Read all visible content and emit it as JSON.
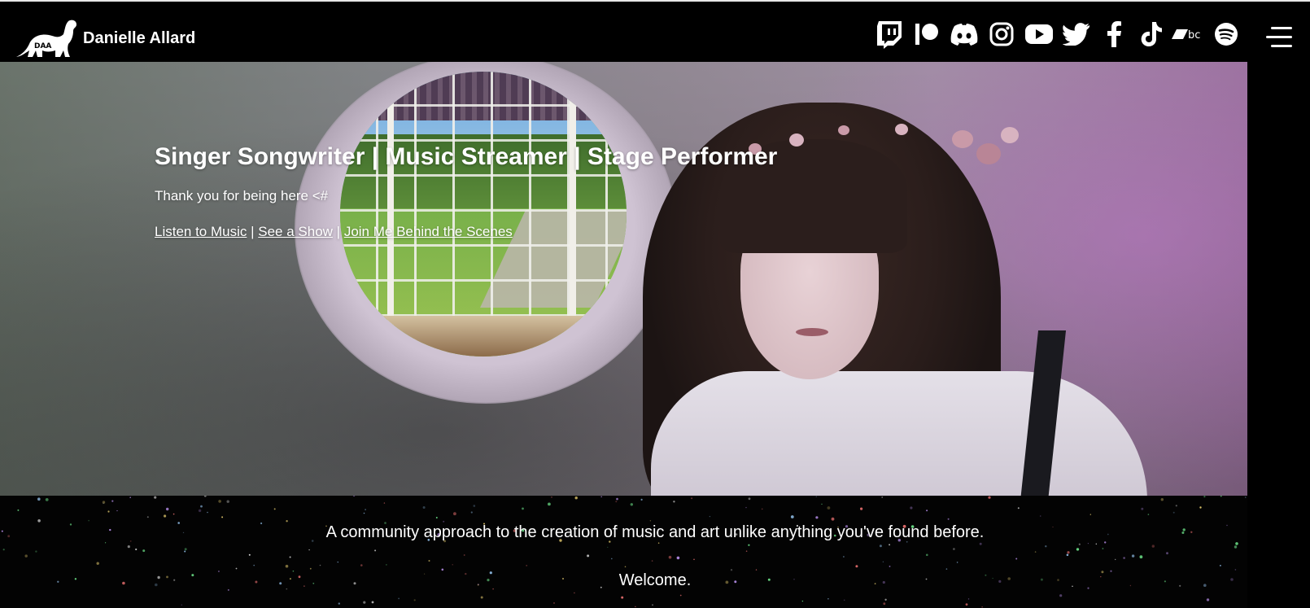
{
  "header": {
    "site_name": "Danielle Allard",
    "logo_text": "DAA",
    "social_icons": [
      {
        "name": "twitch-icon"
      },
      {
        "name": "patreon-icon"
      },
      {
        "name": "discord-icon"
      },
      {
        "name": "instagram-icon"
      },
      {
        "name": "youtube-icon"
      },
      {
        "name": "twitter-icon"
      },
      {
        "name": "facebook-icon"
      },
      {
        "name": "tiktok-icon"
      },
      {
        "name": "bandcamp-icon"
      },
      {
        "name": "spotify-icon"
      }
    ],
    "menu_icon": "hamburger-menu-icon"
  },
  "hero": {
    "title": "Singer Songwriter | Music Streamer | Stage Performer",
    "subtitle": "Thank you for being here <#",
    "links": [
      {
        "label": "Listen to Music"
      },
      {
        "label": "See a Show"
      },
      {
        "label": "Join Me Behind the Scenes"
      }
    ],
    "separator": " | "
  },
  "intro": {
    "tagline": "A community approach to the creation of music and art unlike anything you've found before.",
    "welcome": "Welcome."
  },
  "colors": {
    "background": "#000000",
    "text": "#ffffff",
    "hero_purple": "#9f78a2"
  }
}
